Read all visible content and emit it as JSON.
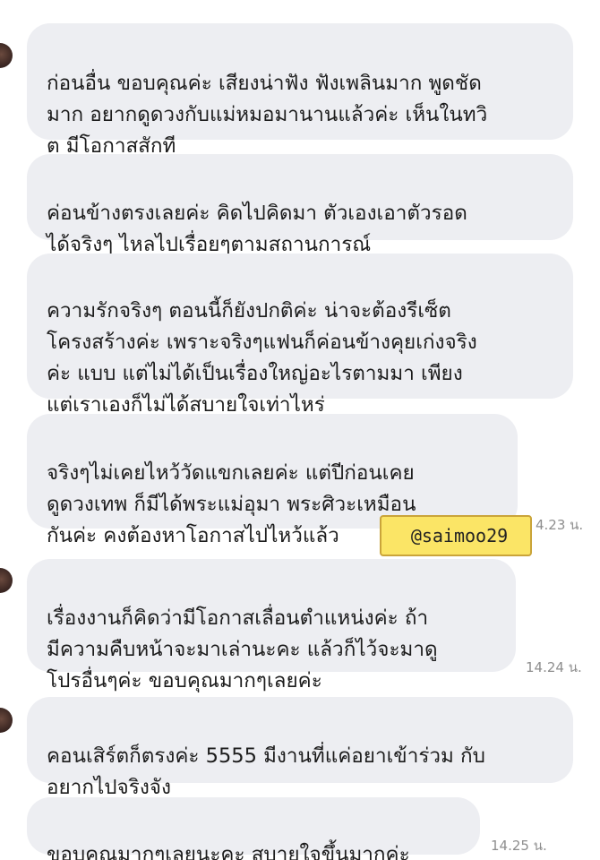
{
  "messages": [
    {
      "text": "ก่อนอื่น ขอบคุณค่ะ เสียงน่าฟัง ฟังเพลินมาก พูดชัดมาก อยากดูดวงกับแม่หมอมานานแล้วค่ะ เห็นในทวิต มีโอกาสสักที",
      "time": ""
    },
    {
      "text": "ค่อนข้างตรงเลยค่ะ คิดไปคิดมา ตัวเองเอาตัวรอดได้จริงๆ ไหลไปเรื่อยๆตามสถานการณ์",
      "time": ""
    },
    {
      "text": "ความรักจริงๆ ตอนนี้ก็ยังปกติค่ะ น่าจะต้องรีเซ็ตโครงสร้างค่ะ เพราะจริงๆแฟนก็ค่อนข้างคุยเก่งจริงค่ะ แบบ แต่ไม่ได้เป็นเรื่องใหญ่อะไรตามมา เพียงแต่เราเองก็ไม่ได้สบายใจเท่าไหร่",
      "time": ""
    },
    {
      "text": "จริงๆไม่เคยไหว้วัดแขกเลยค่ะ แต่ปีก่อนเคยดูดวงเทพ ก็มีได้พระแม่อุมา พระศิวะเหมือนกันค่ะ คงต้องหาโอกาสไปไหว้แล้ว",
      "time": "4.23 น."
    },
    {
      "text": "เรื่องงานก็คิดว่ามีโอกาสเลื่อนตำแหน่งค่ะ ถ้ามีความคืบหน้าจะมาเล่านะคะ แล้วก็ไว้จะมาดูโปรอื่นๆค่ะ ขอบคุณมากๆเลยค่ะ",
      "time": "14.24 น."
    },
    {
      "text": "คอนเสิร์ตก็ตรงค่ะ 5555 มีงานที่แค่อยาเข้าร่วม กับอยากไปจริงจัง",
      "time": ""
    },
    {
      "text": "ขอบคุณมากๆเลยนะคะ สบายใจขึ้นมากค่ะ",
      "time": "14.25 น."
    }
  ],
  "watermark": "@saimoo29",
  "colors": {
    "bubble": "#edeef2",
    "time": "#8e8e8e",
    "sticker": "#fbe566"
  }
}
